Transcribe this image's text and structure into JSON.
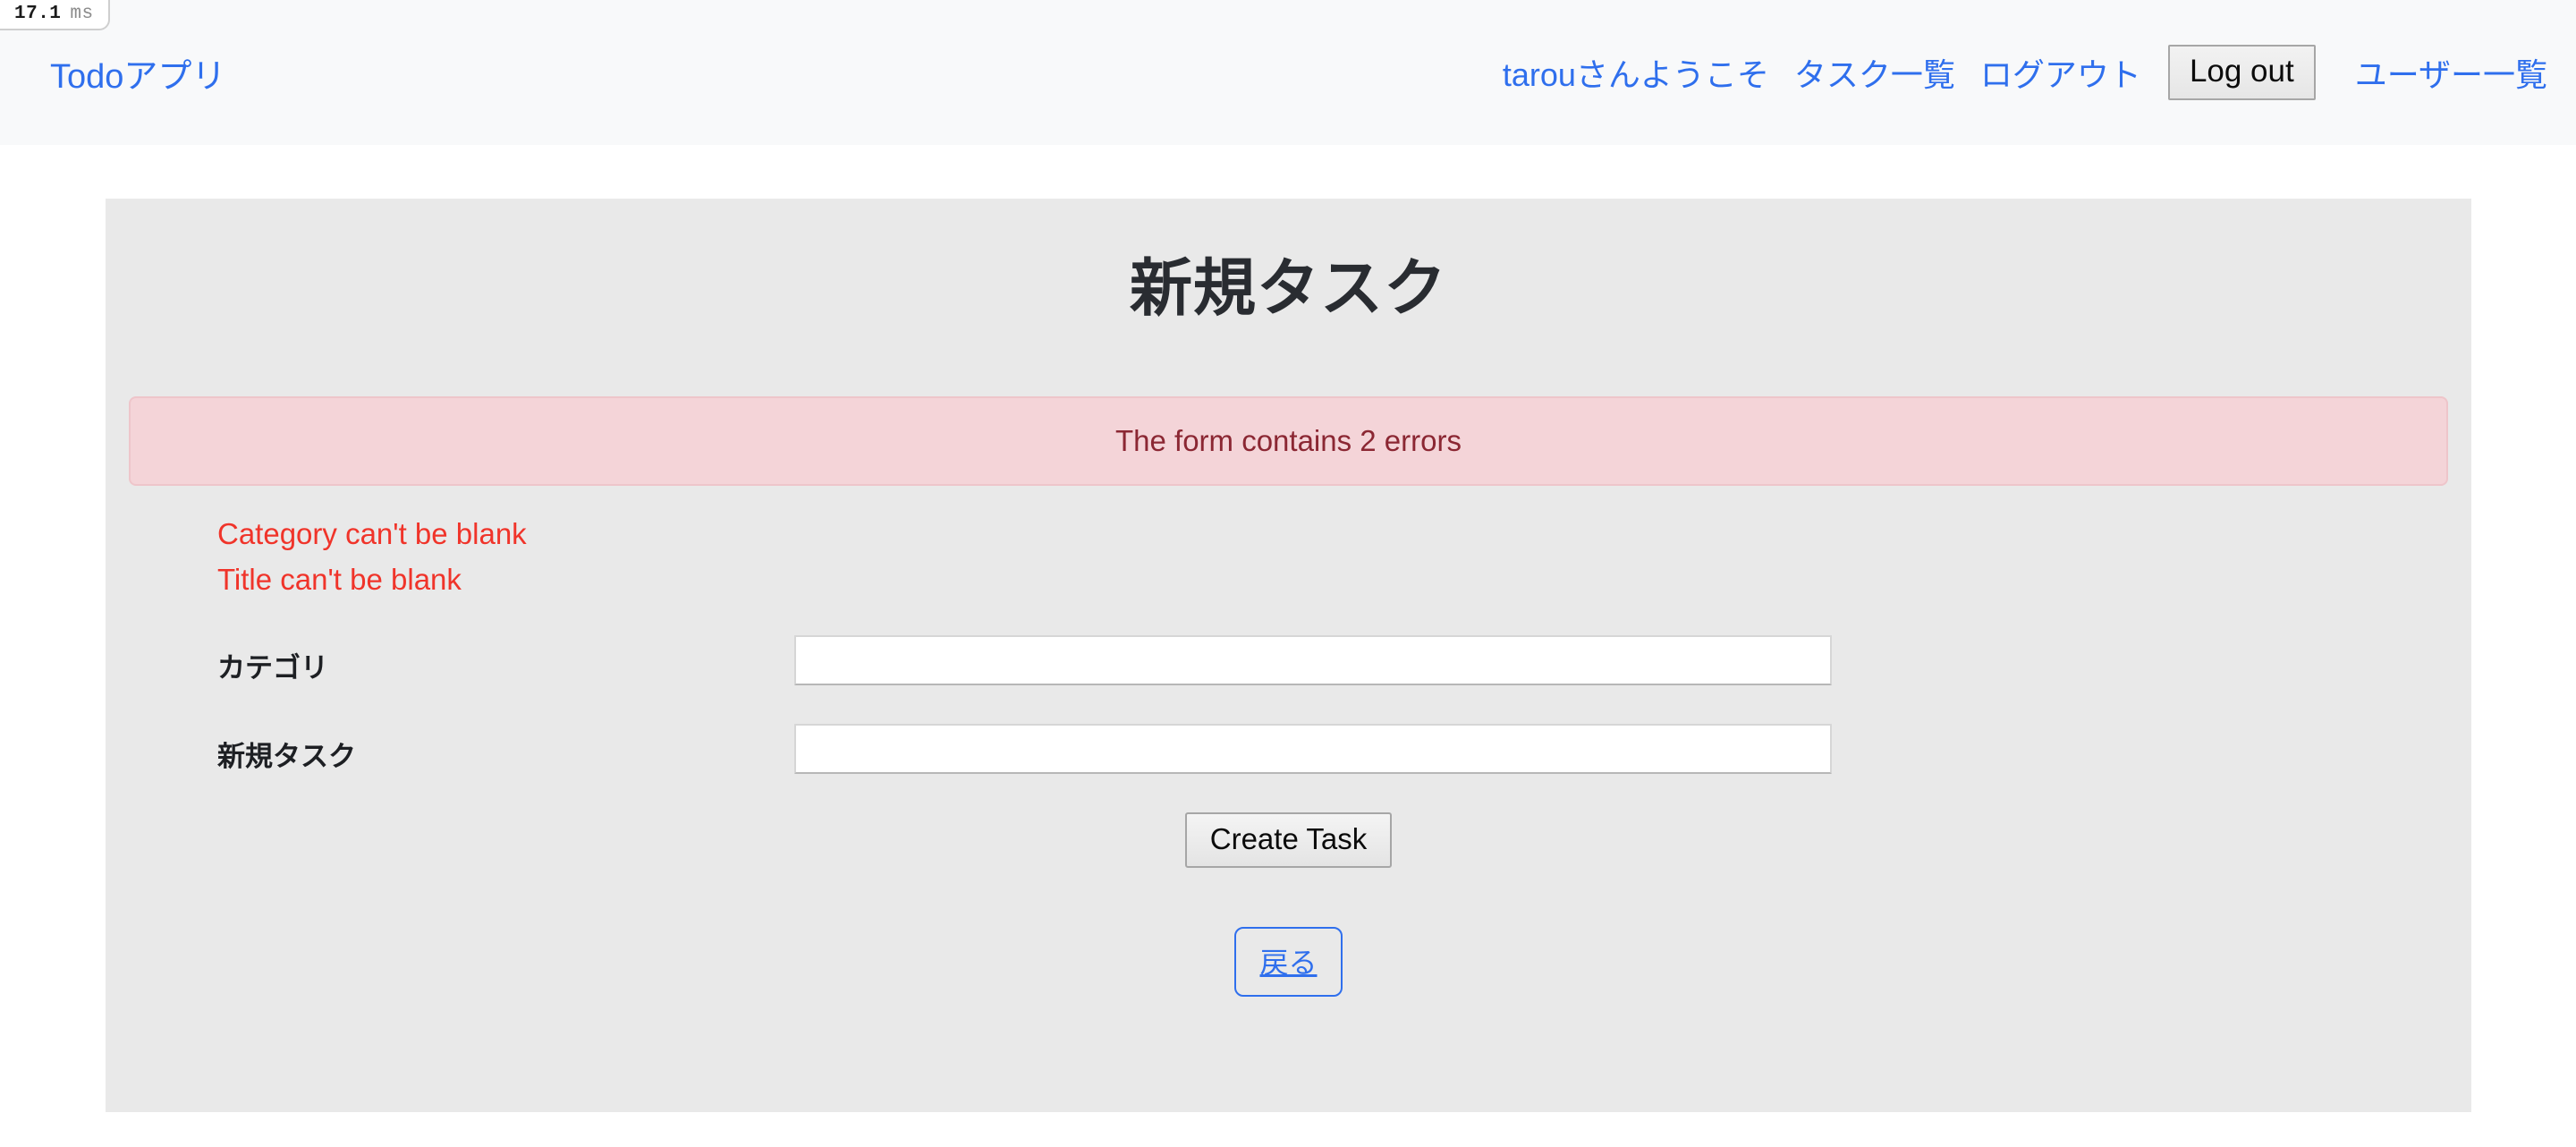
{
  "perf": {
    "value": "17.1",
    "unit": "ms"
  },
  "navbar": {
    "brand": "Todoアプリ",
    "links": [
      {
        "label": "tarouさんようこそ"
      },
      {
        "label": "タスク一覧"
      },
      {
        "label": "ログアウト"
      }
    ],
    "logout_button": "Log out",
    "user_list_label": "ユーザー一覧",
    "link_color": "#2f6fed",
    "background": "#f8f9fa"
  },
  "main": {
    "title": "新規タスク",
    "panel_background": "#e9e9e9",
    "alert": {
      "text": "The form contains 2 errors",
      "background": "#f4d4d8",
      "border_color": "#eec5ca",
      "text_color": "#8b2733"
    },
    "errors": [
      {
        "message": "Category can't be blank"
      },
      {
        "message": "Title can't be blank"
      }
    ],
    "error_color": "#f0342a",
    "form": {
      "fields": [
        {
          "label": "カテゴリ",
          "value": "",
          "placeholder": ""
        },
        {
          "label": "新規タスク",
          "value": "",
          "placeholder": ""
        }
      ],
      "submit_label": "Create Task"
    },
    "back_label": "戻る"
  }
}
